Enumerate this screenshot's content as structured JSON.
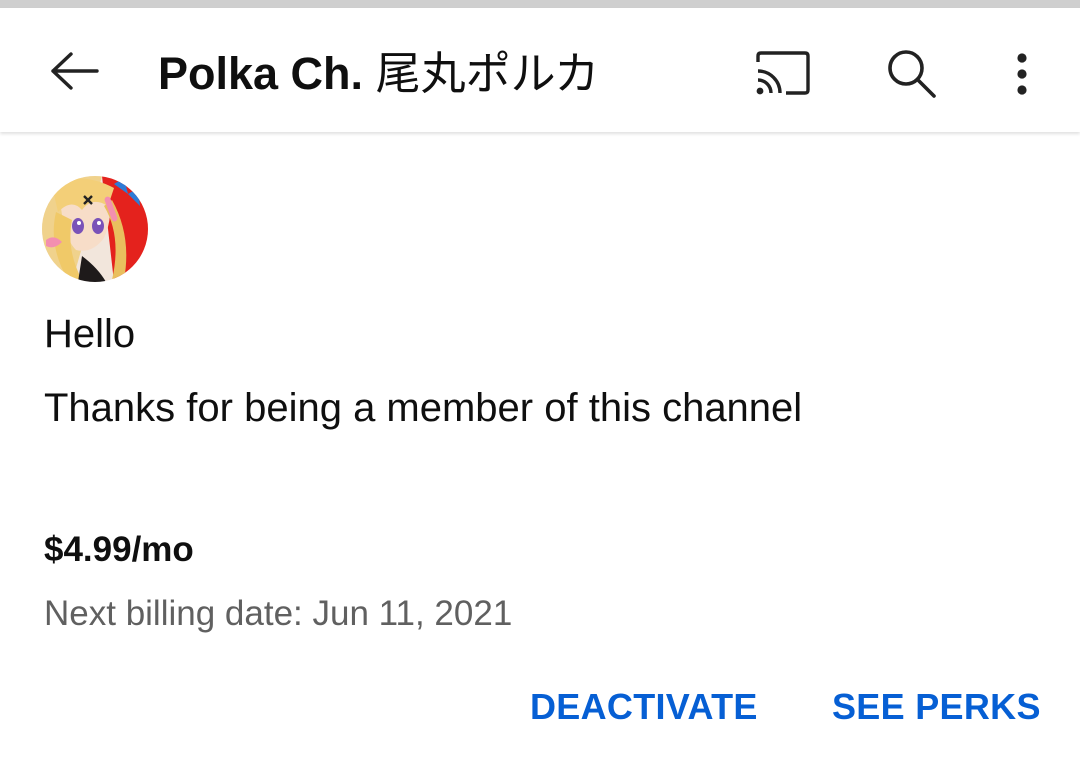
{
  "header": {
    "title": "Polka Ch.",
    "title_jp": "尾丸ポルカ",
    "icons": [
      "back-arrow-icon",
      "cast-icon",
      "search-icon",
      "more-vert-icon"
    ]
  },
  "membership": {
    "greeting": "Hello",
    "message": "Thanks for being a member of this channel",
    "price": "$4.99/mo",
    "next_billing": "Next billing date: Jun 11, 2021"
  },
  "actions": {
    "deactivate": "DEACTIVATE",
    "see_perks": "SEE PERKS"
  },
  "colors": {
    "accent": "#065fd4",
    "text_primary": "#0f0f0f",
    "text_secondary": "#606060"
  }
}
